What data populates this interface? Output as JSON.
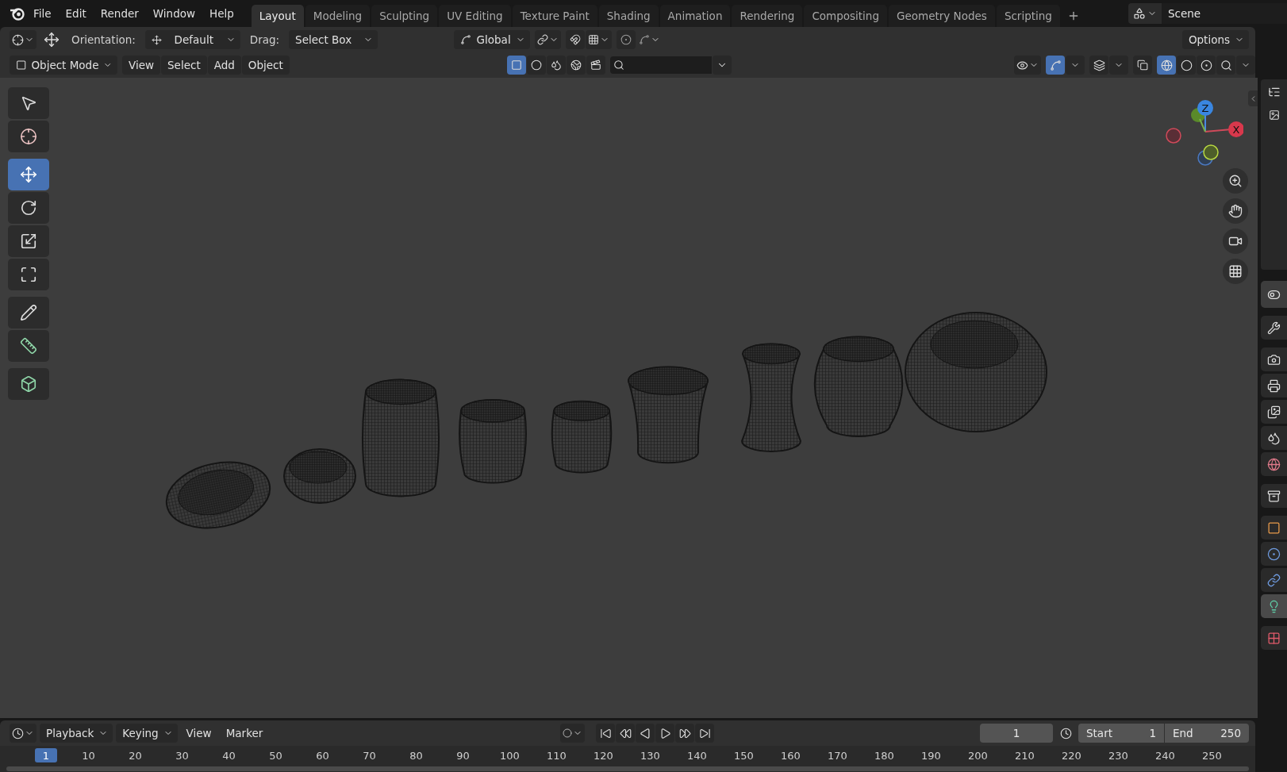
{
  "menu": [
    "File",
    "Edit",
    "Render",
    "Window",
    "Help"
  ],
  "workspaces": [
    {
      "label": "Layout",
      "selected": true
    },
    {
      "label": "Modeling",
      "selected": false
    },
    {
      "label": "Sculpting",
      "selected": false
    },
    {
      "label": "UV Editing",
      "selected": false
    },
    {
      "label": "Texture Paint",
      "selected": false
    },
    {
      "label": "Shading",
      "selected": false
    },
    {
      "label": "Animation",
      "selected": false
    },
    {
      "label": "Rendering",
      "selected": false
    },
    {
      "label": "Compositing",
      "selected": false
    },
    {
      "label": "Geometry Nodes",
      "selected": false
    },
    {
      "label": "Scripting",
      "selected": false
    }
  ],
  "scene": {
    "value": "Scene"
  },
  "tool_settings": {
    "orientation_label": "Orientation:",
    "orientation": "Default",
    "drag_label": "Drag:",
    "drag": "Select Box",
    "transform_orientation": "Global",
    "snap": false,
    "proportional_editing": false,
    "options": "Options"
  },
  "viewport_header": {
    "mode": "Object Mode",
    "menus": [
      "View",
      "Select",
      "Add",
      "Object"
    ],
    "select_modes": [
      {
        "selected": true
      },
      {
        "selected": false
      },
      {
        "selected": false
      },
      {
        "selected": false
      },
      {
        "selected": false
      }
    ],
    "gizmos": true,
    "shading": [
      {
        "selected": true
      },
      {
        "selected": false
      },
      {
        "selected": false
      },
      {
        "selected": false
      }
    ]
  },
  "toolbar": [
    {
      "selected": false
    },
    {
      "selected": false
    },
    {
      "selected": true
    },
    {
      "selected": false
    },
    {
      "selected": false
    },
    {
      "selected": false
    },
    {
      "selected": false
    },
    {
      "selected": false
    },
    {
      "selected": false
    }
  ],
  "gizmo": {
    "z_label": "Z",
    "x_label": "X"
  },
  "properties_tabs": [
    {
      "selected": false
    },
    {
      "selected": false
    },
    {
      "selected": false
    },
    {
      "selected": false
    },
    {
      "selected": false
    },
    {
      "selected": false
    },
    {
      "selected": false
    },
    {
      "selected": false
    },
    {
      "selected": false
    },
    {
      "selected": false
    },
    {
      "selected": false
    },
    {
      "selected": true
    },
    {
      "selected": false
    }
  ],
  "timeline": {
    "menus": [
      "Playback",
      "Keying",
      "View",
      "Marker"
    ],
    "current_frame": "1",
    "start_label": "Start",
    "start": "1",
    "end_label": "End",
    "end": "250",
    "playhead": "1",
    "ruler": [
      "10",
      "20",
      "30",
      "40",
      "50",
      "60",
      "70",
      "80",
      "90",
      "100",
      "110",
      "120",
      "130",
      "140",
      "150",
      "160",
      "170",
      "180",
      "190",
      "200",
      "210",
      "220",
      "230",
      "240",
      "250"
    ]
  }
}
